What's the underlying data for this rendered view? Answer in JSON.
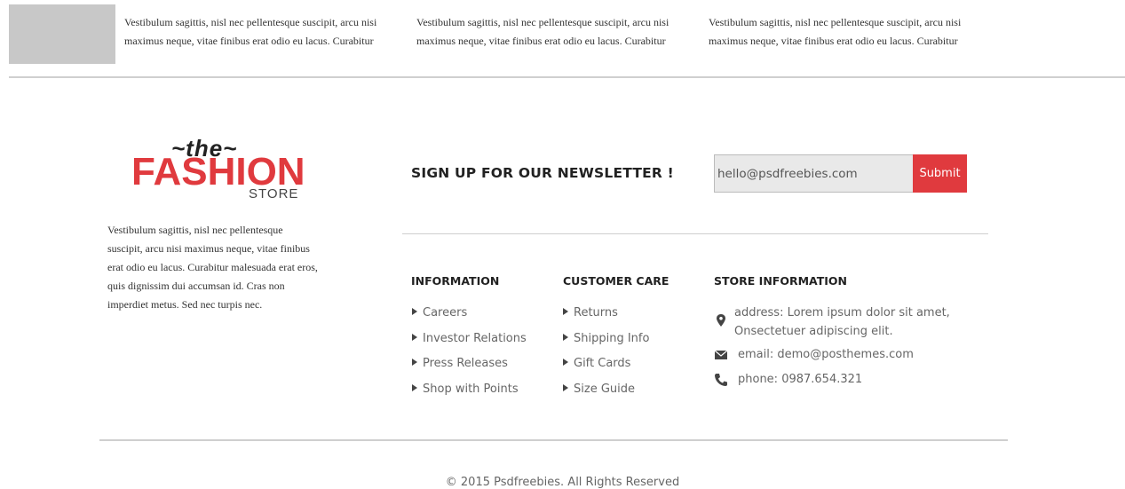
{
  "top_posts": [
    {
      "text": "Vestibulum sagittis, nisl nec pellentesque suscipit, arcu nisi maximus neque, vitae finibus erat odio eu lacus. Curabitur"
    },
    {
      "text": "Vestibulum sagittis, nisl nec pellentesque suscipit, arcu nisi maximus neque, vitae finibus erat odio eu lacus. Curabitur"
    },
    {
      "text": "Vestibulum sagittis, nisl nec pellentesque suscipit, arcu nisi maximus neque, vitae finibus erat odio eu lacus. Curabitur"
    }
  ],
  "logo": {
    "the": "~the~",
    "fashion": "FASHION",
    "store": "STORE"
  },
  "about": "Vestibulum sagittis, nisl nec pellentesque suscipit, arcu nisi maximus neque, vitae finibus erat odio eu lacus. Curabitur malesuada erat eros, quis dignissim dui accumsan id. Cras non imperdiet metus. Sed nec turpis nec.",
  "newsletter": {
    "title": "SIGN UP FOR OUR NEWSLETTER !",
    "email_value": "hello@psdfreebies.com",
    "submit_label": "Submit"
  },
  "information": {
    "title": "INFORMATION",
    "links": [
      "Careers",
      "Investor Relations",
      "Press Releases",
      "Shop with Points"
    ]
  },
  "customer_care": {
    "title": "CUSTOMER CARE",
    "links": [
      "Returns",
      "Shipping Info",
      "Gift Cards",
      "Size Guide"
    ]
  },
  "store_information": {
    "title": "STORE INFORMATION",
    "address_line1": "address: Lorem ipsum dolor sit amet,",
    "address_line2": "Onsectetuer adipiscing elit.",
    "email": "email: demo@posthemes.com",
    "phone": "phone: 0987.654.321",
    "icons": [
      "map-pin-icon",
      "envelope-icon",
      "phone-icon"
    ]
  },
  "copyright": "© 2015 Psdfreebies. All Rights Reserved",
  "colors": {
    "accent": "#e03a3e",
    "divider": "#cfcfcf",
    "thumb": "#c8c8c8"
  }
}
